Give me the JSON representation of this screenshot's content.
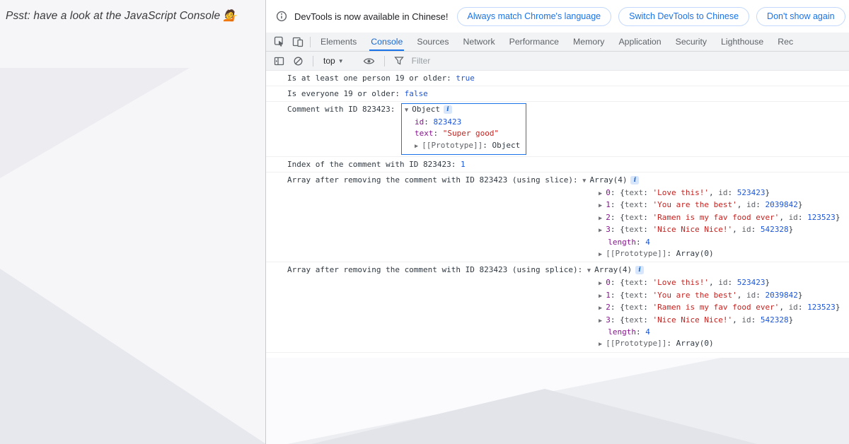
{
  "page": {
    "hint_text": "Psst: have a look at the JavaScript Console 💁"
  },
  "devtools": {
    "notification": {
      "text": "DevTools is now available in Chinese!",
      "buttons": [
        "Always match Chrome's language",
        "Switch DevTools to Chinese",
        "Don't show again"
      ]
    },
    "tabs": {
      "items": [
        "Elements",
        "Console",
        "Sources",
        "Network",
        "Performance",
        "Memory",
        "Application",
        "Security",
        "Lighthouse",
        "Rec"
      ],
      "active": "Console"
    },
    "toolbar": {
      "context": "top",
      "filter_placeholder": "Filter"
    },
    "prompt": ">",
    "console": {
      "messages": [
        {
          "kind": "log",
          "parts": [
            [
              "plain",
              "Is at least one person 19 or older: "
            ],
            [
              "num",
              "true"
            ]
          ]
        },
        {
          "kind": "log",
          "parts": [
            [
              "plain",
              "Is everyone 19 or older: "
            ],
            [
              "num",
              "false"
            ]
          ]
        },
        {
          "kind": "object",
          "label_parts": [
            [
              "plain",
              "Comment with ID 823423: "
            ]
          ],
          "box": {
            "header_parts": [
              [
                "tri",
                "▼ "
              ],
              [
                "plain",
                "Object"
              ],
              [
                "info",
                "i"
              ]
            ],
            "lines": [
              {
                "parts": [
                  [
                    "key",
                    "id"
                  ],
                  [
                    "plain",
                    ": "
                  ],
                  [
                    "num",
                    "823423"
                  ]
                ]
              },
              {
                "parts": [
                  [
                    "key",
                    "text"
                  ],
                  [
                    "plain",
                    ": "
                  ],
                  [
                    "str",
                    "\"Super good\""
                  ]
                ]
              },
              {
                "parts": [
                  [
                    "tri",
                    "▶ "
                  ],
                  [
                    "proto",
                    "[[Prototype]]"
                  ],
                  [
                    "plain",
                    ": "
                  ],
                  [
                    "plain",
                    "Object"
                  ]
                ]
              }
            ]
          }
        },
        {
          "kind": "log",
          "parts": [
            [
              "plain",
              "Index of the comment with ID 823423: "
            ],
            [
              "num",
              "1"
            ]
          ]
        },
        {
          "kind": "tree",
          "label_parts": [
            [
              "plain",
              "Array after removing the comment with ID 823423 (using slice): "
            ],
            [
              "tri",
              "▼ "
            ],
            [
              "plain",
              "Array(4)"
            ],
            [
              "info",
              "i"
            ]
          ],
          "children": [
            {
              "parts": [
                [
                  "tri",
                  "▶ "
                ],
                [
                  "key",
                  "0"
                ],
                [
                  "plain",
                  ": {"
                ],
                [
                  "pkey",
                  "text"
                ],
                [
                  "plain",
                  ": "
                ],
                [
                  "str",
                  "'Love this!'"
                ],
                [
                  "plain",
                  ", "
                ],
                [
                  "pkey",
                  "id"
                ],
                [
                  "plain",
                  ": "
                ],
                [
                  "num",
                  "523423"
                ],
                [
                  "plain",
                  "}"
                ]
              ]
            },
            {
              "parts": [
                [
                  "tri",
                  "▶ "
                ],
                [
                  "key",
                  "1"
                ],
                [
                  "plain",
                  ": {"
                ],
                [
                  "pkey",
                  "text"
                ],
                [
                  "plain",
                  ": "
                ],
                [
                  "str",
                  "'You are the best'"
                ],
                [
                  "plain",
                  ", "
                ],
                [
                  "pkey",
                  "id"
                ],
                [
                  "plain",
                  ": "
                ],
                [
                  "num",
                  "2039842"
                ],
                [
                  "plain",
                  "}"
                ]
              ]
            },
            {
              "parts": [
                [
                  "tri",
                  "▶ "
                ],
                [
                  "key",
                  "2"
                ],
                [
                  "plain",
                  ": {"
                ],
                [
                  "pkey",
                  "text"
                ],
                [
                  "plain",
                  ": "
                ],
                [
                  "str",
                  "'Ramen is my fav food ever'"
                ],
                [
                  "plain",
                  ", "
                ],
                [
                  "pkey",
                  "id"
                ],
                [
                  "plain",
                  ": "
                ],
                [
                  "num",
                  "123523"
                ],
                [
                  "plain",
                  "}"
                ]
              ]
            },
            {
              "parts": [
                [
                  "tri",
                  "▶ "
                ],
                [
                  "key",
                  "3"
                ],
                [
                  "plain",
                  ": {"
                ],
                [
                  "pkey",
                  "text"
                ],
                [
                  "plain",
                  ": "
                ],
                [
                  "str",
                  "'Nice Nice Nice!'"
                ],
                [
                  "plain",
                  ", "
                ],
                [
                  "pkey",
                  "id"
                ],
                [
                  "plain",
                  ": "
                ],
                [
                  "num",
                  "542328"
                ],
                [
                  "plain",
                  "}"
                ]
              ]
            },
            {
              "parts": [
                [
                  "plain",
                  "  "
                ],
                [
                  "key",
                  "length"
                ],
                [
                  "plain",
                  ": "
                ],
                [
                  "num",
                  "4"
                ]
              ]
            },
            {
              "parts": [
                [
                  "tri",
                  "▶ "
                ],
                [
                  "proto",
                  "[[Prototype]]"
                ],
                [
                  "plain",
                  ": "
                ],
                [
                  "plain",
                  "Array(0)"
                ]
              ]
            }
          ]
        },
        {
          "kind": "tree",
          "label_parts": [
            [
              "plain",
              "Array after removing the comment with ID 823423 (using splice): "
            ],
            [
              "tri",
              "▼ "
            ],
            [
              "plain",
              "Array(4)"
            ],
            [
              "info",
              "i"
            ]
          ],
          "children": [
            {
              "parts": [
                [
                  "tri",
                  "▶ "
                ],
                [
                  "key",
                  "0"
                ],
                [
                  "plain",
                  ": {"
                ],
                [
                  "pkey",
                  "text"
                ],
                [
                  "plain",
                  ": "
                ],
                [
                  "str",
                  "'Love this!'"
                ],
                [
                  "plain",
                  ", "
                ],
                [
                  "pkey",
                  "id"
                ],
                [
                  "plain",
                  ": "
                ],
                [
                  "num",
                  "523423"
                ],
                [
                  "plain",
                  "}"
                ]
              ]
            },
            {
              "parts": [
                [
                  "tri",
                  "▶ "
                ],
                [
                  "key",
                  "1"
                ],
                [
                  "plain",
                  ": {"
                ],
                [
                  "pkey",
                  "text"
                ],
                [
                  "plain",
                  ": "
                ],
                [
                  "str",
                  "'You are the best'"
                ],
                [
                  "plain",
                  ", "
                ],
                [
                  "pkey",
                  "id"
                ],
                [
                  "plain",
                  ": "
                ],
                [
                  "num",
                  "2039842"
                ],
                [
                  "plain",
                  "}"
                ]
              ]
            },
            {
              "parts": [
                [
                  "tri",
                  "▶ "
                ],
                [
                  "key",
                  "2"
                ],
                [
                  "plain",
                  ": {"
                ],
                [
                  "pkey",
                  "text"
                ],
                [
                  "plain",
                  ": "
                ],
                [
                  "str",
                  "'Ramen is my fav food ever'"
                ],
                [
                  "plain",
                  ", "
                ],
                [
                  "pkey",
                  "id"
                ],
                [
                  "plain",
                  ": "
                ],
                [
                  "num",
                  "123523"
                ],
                [
                  "plain",
                  "}"
                ]
              ]
            },
            {
              "parts": [
                [
                  "tri",
                  "▶ "
                ],
                [
                  "key",
                  "3"
                ],
                [
                  "plain",
                  ": {"
                ],
                [
                  "pkey",
                  "text"
                ],
                [
                  "plain",
                  ": "
                ],
                [
                  "str",
                  "'Nice Nice Nice!'"
                ],
                [
                  "plain",
                  ", "
                ],
                [
                  "pkey",
                  "id"
                ],
                [
                  "plain",
                  ": "
                ],
                [
                  "num",
                  "542328"
                ],
                [
                  "plain",
                  "}"
                ]
              ]
            },
            {
              "parts": [
                [
                  "plain",
                  "  "
                ],
                [
                  "key",
                  "length"
                ],
                [
                  "plain",
                  ": "
                ],
                [
                  "num",
                  "4"
                ]
              ]
            },
            {
              "parts": [
                [
                  "tri",
                  "▶ "
                ],
                [
                  "proto",
                  "[[Prototype]]"
                ],
                [
                  "plain",
                  ": "
                ],
                [
                  "plain",
                  "Array(0)"
                ]
              ]
            }
          ]
        }
      ]
    }
  },
  "colors": {
    "accent": "#1a73e8",
    "string": "#c5221f",
    "number": "#1a56db",
    "key": "#881391",
    "active_tab": "#1967d2"
  }
}
